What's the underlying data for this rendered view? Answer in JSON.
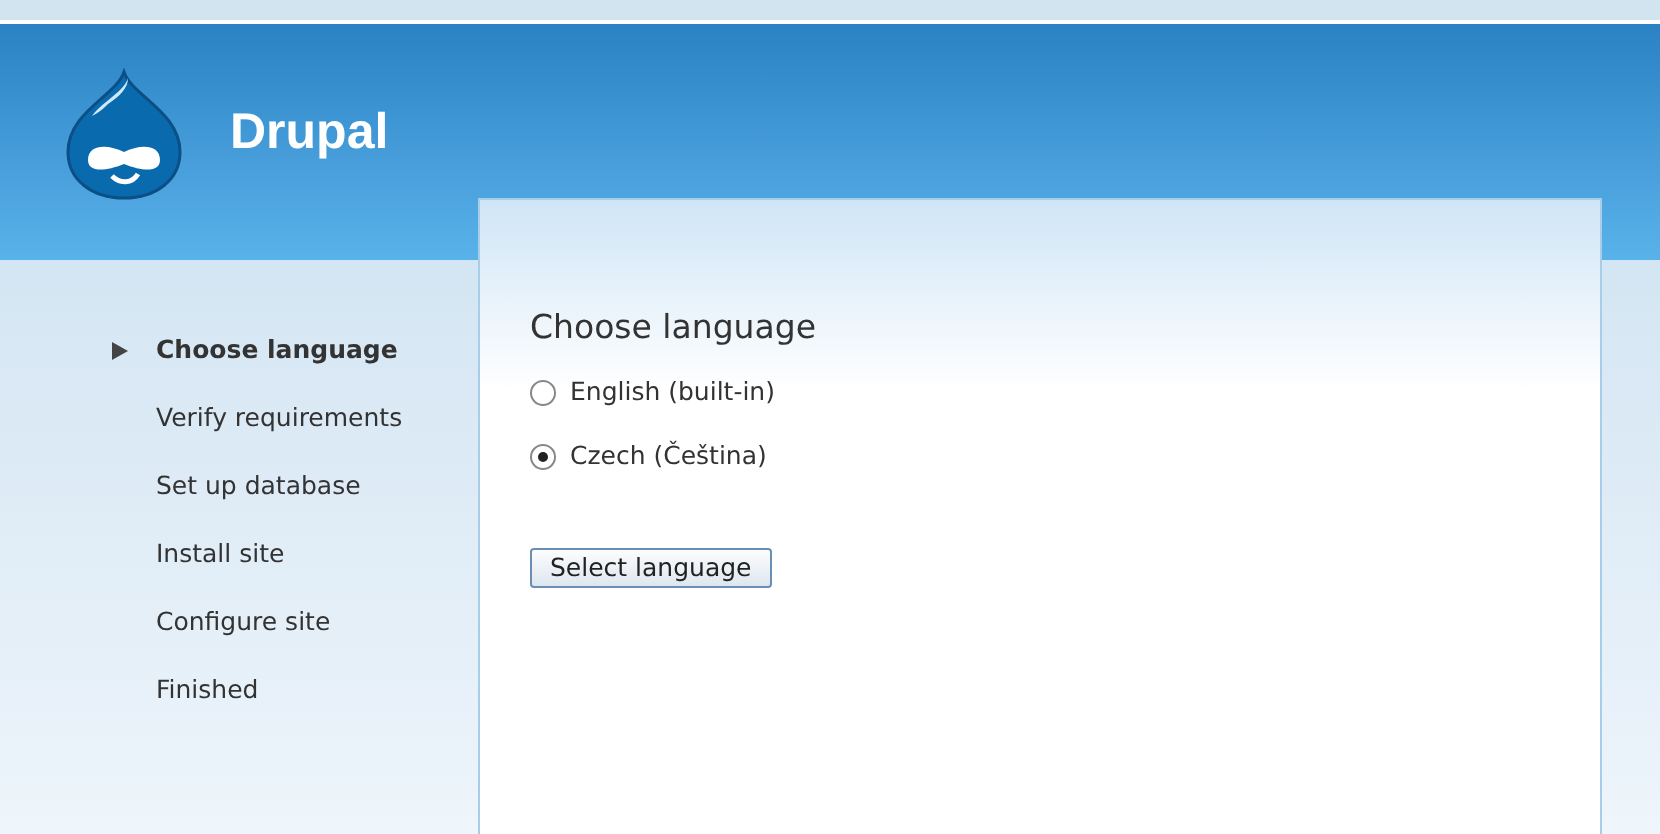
{
  "header": {
    "site_name": "Drupal"
  },
  "steps": [
    {
      "label": "Choose language",
      "selected": true
    },
    {
      "label": "Verify requirements",
      "selected": false
    },
    {
      "label": "Set up database",
      "selected": false
    },
    {
      "label": "Install site",
      "selected": false
    },
    {
      "label": "Configure site",
      "selected": false
    },
    {
      "label": "Finished",
      "selected": false
    }
  ],
  "panel": {
    "title": "Choose language",
    "options": [
      {
        "label": "English (built-in)",
        "selected": false
      },
      {
        "label": "Czech (Čeština)",
        "selected": true
      }
    ],
    "button": "Select language"
  }
}
